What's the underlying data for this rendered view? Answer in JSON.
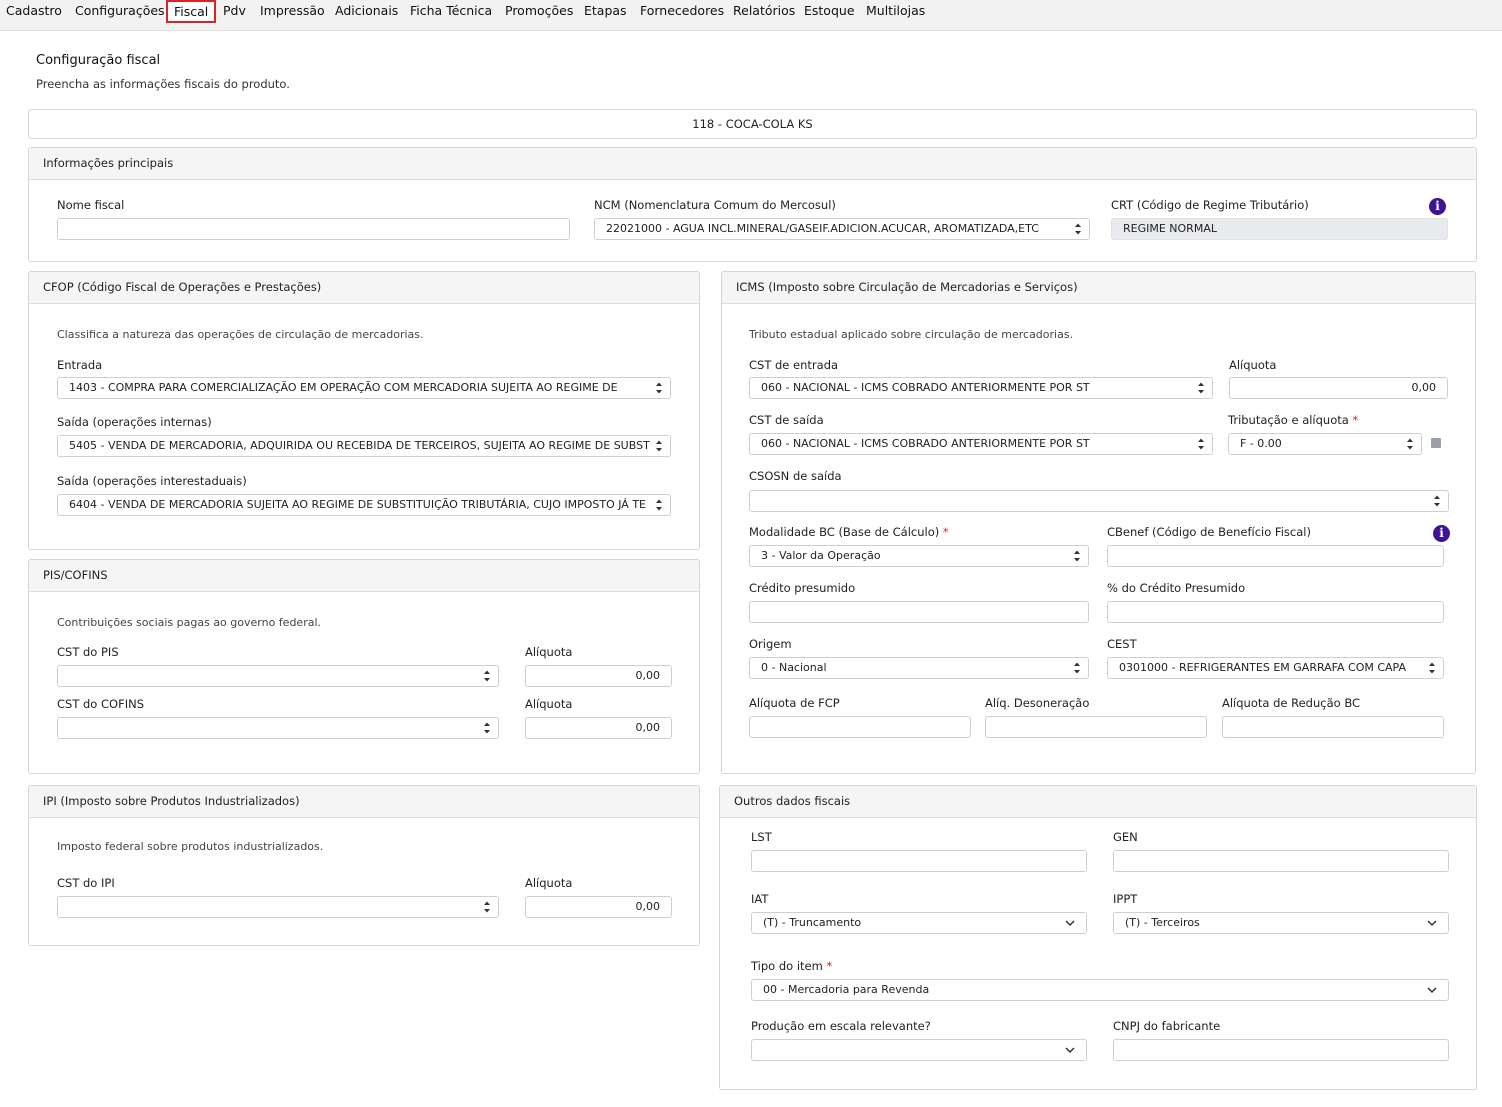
{
  "tabs": [
    "Cadastro",
    "Configurações",
    "Fiscal",
    "Pdv",
    "Impressão",
    "Adicionais",
    "Ficha Técnica",
    "Promoções",
    "Etapas",
    "Fornecedores",
    "Relatórios",
    "Estoque",
    "Multilojas"
  ],
  "page": {
    "title": "Configuração fiscal",
    "subtitle": "Preencha as informações fiscais do produto.",
    "product": "118 - COCA-COLA KS"
  },
  "main_info": {
    "header": "Informações principais",
    "nome_fiscal_label": "Nome fiscal",
    "nome_fiscal_value": "",
    "ncm_label": "NCM (Nomenclatura Comum do Mercosul)",
    "ncm_value": "22021000 - AGUA INCL.MINERAL/GASEIF.ADICION.ACUCAR, AROMATIZADA,ETC",
    "crt_label": "CRT (Código de Regime Tributário)",
    "crt_value": "REGIME NORMAL"
  },
  "cfop": {
    "header": "CFOP (Código Fiscal de Operações e Prestações)",
    "desc": "Classifica a natureza das operações de circulação de mercadorias.",
    "entrada_label": "Entrada",
    "entrada_value": "1403 - COMPRA PARA COMERCIALIZAÇÃO EM OPERAÇÃO COM MERCADORIA SUJEITA AO REGIME DE",
    "saida_int_label": "Saída (operações internas)",
    "saida_int_value": "5405 - VENDA DE MERCADORIA, ADQUIRIDA OU RECEBIDA DE TERCEIROS, SUJEITA AO REGIME DE SUBST",
    "saida_inter_label": "Saída (operações interestaduais)",
    "saida_inter_value": "6404 - VENDA DE MERCADORIA SUJEITA AO REGIME DE SUBSTITUIÇÃO TRIBUTÁRIA, CUJO IMPOSTO JÁ TE"
  },
  "pis": {
    "header": "PIS/COFINS",
    "desc": "Contribuições sociais pagas ao governo federal.",
    "cst_pis_label": "CST do PIS",
    "cst_pis_value": "",
    "aliq_label": "Alíquota",
    "aliq_pis_value": "0,00",
    "cst_cofins_label": "CST do COFINS",
    "cst_cofins_value": "",
    "aliq_cofins_value": "0,00"
  },
  "ipi": {
    "header": "IPI (Imposto sobre Produtos Industrializados)",
    "desc": "Imposto federal sobre produtos industrializados.",
    "cst_label": "CST do IPI",
    "cst_value": "",
    "aliq_label": "Alíquota",
    "aliq_value": "0,00"
  },
  "icms": {
    "header": "ICMS (Imposto sobre Circulação de Mercadorias e Serviços)",
    "desc": "Tributo estadual aplicado sobre circulação de mercadorias.",
    "cst_entrada_label": "CST de entrada",
    "cst_entrada_value": "060 - NACIONAL - ICMS COBRADO ANTERIORMENTE POR ST",
    "aliq_label": "Alíquota",
    "aliq_value": "0,00",
    "cst_saida_label": "CST de saída",
    "cst_saida_value": "060 - NACIONAL - ICMS COBRADO ANTERIORMENTE POR ST",
    "trib_label": "Tributação e alíquota",
    "trib_value": "F - 0.00",
    "csosn_label": "CSOSN de saída",
    "csosn_value": "",
    "mod_bc_label": "Modalidade BC (Base de Cálculo)",
    "mod_bc_value": "3 - Valor da Operação",
    "cbenef_label": "CBenef (Código de Benefício Fiscal)",
    "cbenef_value": "",
    "cred_pres_label": "Crédito presumido",
    "cred_pres_value": "",
    "pct_cred_label": "% do Crédito Presumido",
    "pct_cred_value": "",
    "origem_label": "Origem",
    "origem_value": "0 - Nacional",
    "cest_label": "CEST",
    "cest_value": "0301000 - REFRIGERANTES EM GARRAFA COM CAPA",
    "fcp_label": "Alíquota de FCP",
    "fcp_value": "",
    "deson_label": "Alíq. Desoneração",
    "deson_value": "",
    "red_bc_label": "Alíquota de Redução BC",
    "red_bc_value": ""
  },
  "outros": {
    "header": "Outros dados fiscais",
    "lst_label": "LST",
    "lst_value": "",
    "gen_label": "GEN",
    "gen_value": "",
    "iat_label": "IAT",
    "iat_value": "(T) - Truncamento",
    "ippt_label": "IPPT",
    "ippt_value": "(T) - Terceiros",
    "tipo_label": "Tipo do item",
    "tipo_value": "00 - Mercadoria para Revenda",
    "escala_label": "Produção em escala relevante?",
    "escala_value": "",
    "cnpj_label": "CNPJ do fabricante",
    "cnpj_value": ""
  },
  "colors": {
    "accent_red": "#d9232c",
    "info_purple": "#3e1591"
  },
  "icons": [
    "info-icon",
    "calculator-icon",
    "select-arrows-icon",
    "chevron-down-icon"
  ]
}
